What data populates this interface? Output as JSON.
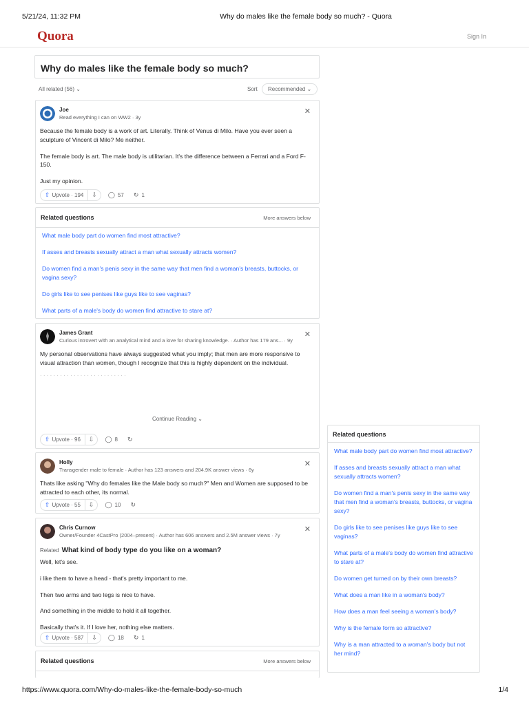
{
  "print": {
    "datetime": "5/21/24, 11:32 PM",
    "page_title": "Why do males like the female body so much? - Quora",
    "url": "https://www.quora.com/Why-do-males-like-the-female-body-so-much",
    "page_num": "1/4"
  },
  "header": {
    "logo": "Quora",
    "signin": "Sign In"
  },
  "question": {
    "title": "Why do males like the female body so much?"
  },
  "filter": {
    "all_related": "All related (56)",
    "sort_label": "Sort",
    "sort_value": "Recommended"
  },
  "answers": [
    {
      "name": "Joe",
      "cred": "Read everything I can on WW2 · 3y",
      "paragraphs": [
        "Because the female body is a work of art. Literally. Think of Venus di Milo. Have you ever seen a sculpture of Vincent di Milo? Me neither.",
        "The female body is art. The male body is utilitarian. It's the difference between a Ferrari and a Ford F-150.",
        "Just my opinion."
      ],
      "upvote": "Upvote · 194",
      "comments": "57",
      "shares": "1"
    },
    {
      "name": "James Grant",
      "cred": "Curious introvert with an analytical mind and a love for sharing knowledge. · Author has 179 ans... · 9y",
      "paragraphs": [
        "My personal observations have always suggested what you imply; that men are more responsive to visual attraction than women, though I recognize that this is highly dependent on the individual."
      ],
      "continue": "Continue Reading",
      "upvote": "Upvote · 96",
      "comments": "8",
      "shares": ""
    },
    {
      "name": "Holly",
      "cred": "Transgender male to female · Author has 123 answers and 204.9K answer views · 6y",
      "paragraphs": [
        "Thats like asking \"Why do females like the Male body so much?\" Men and Women are supposed to be attracted to each other, its normal."
      ],
      "upvote": "Upvote · 55",
      "comments": "10",
      "shares": ""
    },
    {
      "name": "Chris Curnow",
      "cred": "Owner/Founder 4CastPro (2004–present) · Author has 606 answers and 2.5M answer views · 7y",
      "related_tag": "Related",
      "related_q": "What kind of body type do you like on a woman?",
      "paragraphs": [
        "Well, let's see.",
        "i like them to have a head - that's pretty important to me.",
        "Then two arms and two legs is nice to have.",
        "And something in the middle to hold it all together.",
        "Basically that's it. If I love her, nothing else matters."
      ],
      "upvote": "Upvote · 587",
      "comments": "18",
      "shares": "1"
    }
  ],
  "related_block": {
    "title": "Related questions",
    "more": "More answers below",
    "items": [
      "What male body part do women find most attractive?",
      "If asses and breasts sexually attract a man what sexually attracts women?",
      "Do women find a man's penis sexy in the same way that men find a woman's breasts, buttocks, or vagina sexy?",
      "Do girls like to see penises like guys like to see vaginas?",
      "What parts of a male's body do women find attractive to stare at?"
    ]
  },
  "related_block_2": {
    "title": "Related questions",
    "more": "More answers below"
  },
  "sidebar": {
    "title": "Related questions",
    "items": [
      "What male body part do women find most attractive?",
      "If asses and breasts sexually attract a man what sexually attracts women?",
      "Do women find a man's penis sexy in the same way that men find a woman's breasts, buttocks, or vagina sexy?",
      "Do girls like to see penises like guys like to see vaginas?",
      "What parts of a male's body do women find attractive to stare at?",
      "Do women get turned on by their own breasts?",
      "What does a man like in a woman's body?",
      "How does a man feel seeing a woman's body?",
      "Why is the female form so attractive?",
      "Why is a man attracted to a woman's body but not her mind?"
    ]
  },
  "icons": {
    "upvote": "upvote-arrow-icon",
    "downvote": "downvote-arrow-icon",
    "comment": "comment-bubble-icon",
    "share": "share-icon",
    "close": "close-icon",
    "chevron": "chevron-down-icon"
  },
  "colors": {
    "brand": "#b92b27",
    "link": "#2e69ff",
    "border": "#dee0e1"
  }
}
